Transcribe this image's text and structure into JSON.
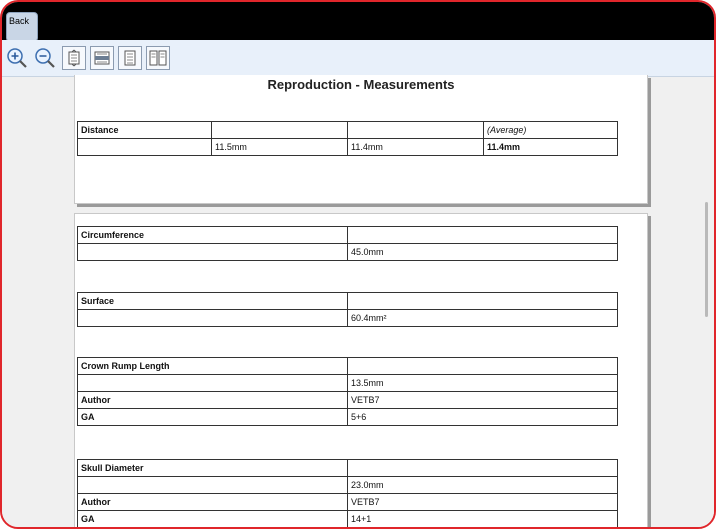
{
  "window": {
    "back_label": "Back"
  },
  "toolbar": {
    "icons": [
      "zoom-in-icon",
      "zoom-out-icon",
      "fit-page-icon",
      "fit-width-icon",
      "single-page-icon",
      "two-page-icon"
    ]
  },
  "report": {
    "title": "Reproduction - Measurements",
    "distance": {
      "label": "Distance",
      "average_label": "(Average)",
      "values": [
        "11.5mm",
        "11.4mm"
      ],
      "average": "11.4mm"
    },
    "circumference": {
      "label": "Circumference",
      "value": "45.0mm"
    },
    "surface": {
      "label": "Surface",
      "value": "60.4mm²"
    },
    "crl": {
      "label": "Crown Rump Length",
      "value": "13.5mm",
      "author_label": "Author",
      "author": "VETB7",
      "ga_label": "GA",
      "ga": "5+6"
    },
    "skull": {
      "label": "Skull Diameter",
      "value": "23.0mm",
      "author_label": "Author",
      "author": "VETB7",
      "ga_label": "GA",
      "ga": "14+1"
    }
  },
  "colors": {
    "frame": "#e0262b",
    "titlebar": "#000000",
    "toolbar": "#e8f0fa"
  }
}
